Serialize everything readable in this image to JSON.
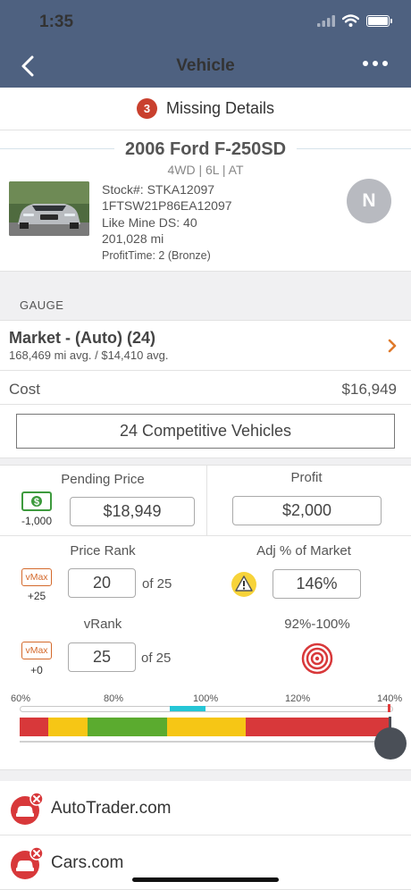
{
  "status_bar": {
    "time": "1:35"
  },
  "nav": {
    "title": "Vehicle"
  },
  "missing": {
    "count": "3",
    "label": "Missing Details"
  },
  "vehicle": {
    "title": "2006 Ford F-250SD",
    "subtitle": "4WD | 6L | AT",
    "stock": "Stock#: STKA12097",
    "vin": "1FTSW21P86EA12097",
    "like_mine": "Like Mine DS: 40",
    "miles": "201,028 mi",
    "profit_time": "ProfitTime: 2 (Bronze)",
    "avatar_letter": "N"
  },
  "gauge": {
    "section_label": "GAUGE",
    "market_title": "Market - (Auto) (24)",
    "market_sub": "168,469 mi avg. / $14,410 avg.",
    "cost_label": "Cost",
    "cost_value": "$16,949",
    "competitive_button": "24 Competitive Vehicles"
  },
  "pricing": {
    "pending_label": "Pending Price",
    "pending_value": "$18,949",
    "pending_delta": "-1,000",
    "profit_label": "Profit",
    "profit_value": "$2,000",
    "price_rank_label": "Price Rank",
    "price_rank_value": "20",
    "price_rank_of": "of 25",
    "price_rank_delta": "+25",
    "adj_label": "Adj % of Market",
    "adj_value": "146%",
    "vrank_label": "vRank",
    "vrank_value": "25",
    "vrank_of": "of 25",
    "vrank_delta": "+0",
    "range_label": "92%-100%",
    "vmax_label": "vMax",
    "scale_labels": [
      "60%",
      "80%",
      "100%",
      "120%",
      "140%"
    ],
    "marker_percent": 146,
    "colors": {
      "red": "#d8383a",
      "yellow": "#f6c615",
      "green": "#5bab2f",
      "cyan": "#25c6d6"
    }
  },
  "sites": [
    {
      "label": "AutoTrader.com"
    },
    {
      "label": "Cars.com"
    }
  ],
  "icons": [
    "back-icon",
    "more-icon",
    "wifi-icon",
    "battery-icon",
    "signal-icon",
    "chevron-right-icon",
    "dollar-icon",
    "warning-icon",
    "target-icon",
    "car-error-icon"
  ]
}
